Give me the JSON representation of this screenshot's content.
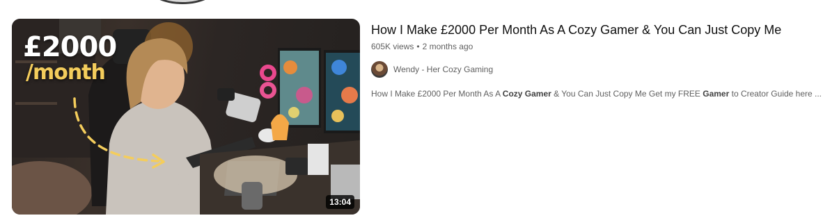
{
  "video": {
    "thumbnail": {
      "overlay_line1": "£2000",
      "overlay_line2": "/month",
      "duration": "13:04",
      "accent_color": "#f4cd5c"
    },
    "title": "How I Make £2000 Per Month As A Cozy Gamer & You Can Just Copy Me",
    "views": "605K views",
    "separator": "•",
    "age": "2 months ago",
    "channel": {
      "name": "Wendy - Her Cozy Gaming",
      "avatar_icon": "channel-avatar"
    },
    "description": {
      "part1": "How I Make £2000 Per Month As A ",
      "bold1": "Cozy Gamer",
      "part2": " & You Can Just Copy Me Get my FREE ",
      "bold2": "Gamer",
      "part3": " to Creator Guide here ..."
    }
  }
}
